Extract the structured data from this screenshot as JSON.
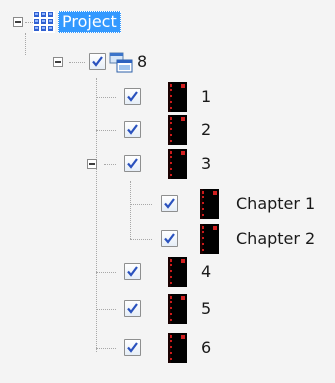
{
  "tree": {
    "root": {
      "label": "Project",
      "icon": "project-grid-icon",
      "selected": true,
      "expanded": true
    },
    "group": {
      "label": "8",
      "icon": "windows-stack-icon",
      "checked": true,
      "expanded": true
    },
    "items": [
      {
        "label": "1",
        "icon": "book-icon",
        "checked": true
      },
      {
        "label": "2",
        "icon": "book-icon",
        "checked": true
      },
      {
        "label": "3",
        "icon": "book-icon",
        "checked": true,
        "expanded": true
      },
      {
        "label": "Chapter 1",
        "icon": "book-icon",
        "checked": true
      },
      {
        "label": "Chapter 2",
        "icon": "book-icon",
        "checked": true
      },
      {
        "label": "4",
        "icon": "book-icon",
        "checked": true
      },
      {
        "label": "5",
        "icon": "book-icon",
        "checked": true
      },
      {
        "label": "6",
        "icon": "book-icon",
        "checked": true
      }
    ]
  },
  "colors": {
    "selection": "#3399ff",
    "background": "#f4f4f4",
    "book_cover": "#000000",
    "book_spine_accent": "#cc1a1a",
    "check_mark": "#2a52be"
  }
}
